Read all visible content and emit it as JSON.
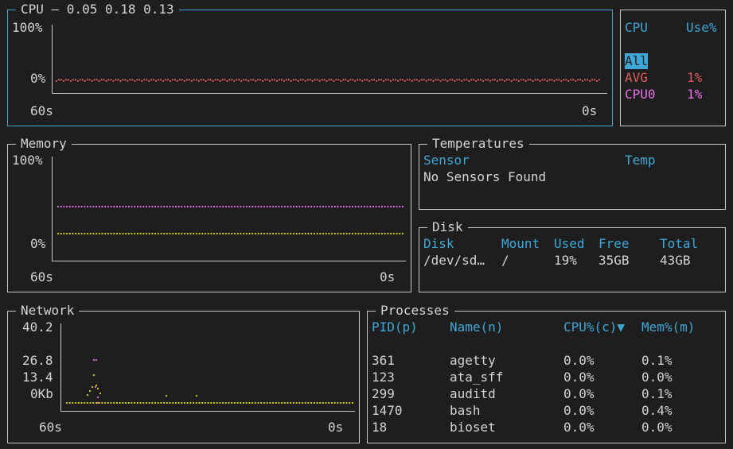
{
  "cpu": {
    "title": "CPU — 0.05 0.18 0.13",
    "y_max": "100%",
    "y_min": "0%",
    "x_start": "60s",
    "x_end": "0s",
    "line_color": "#e05b5b",
    "series_percent": [
      1,
      1,
      1,
      1,
      1,
      1,
      1,
      1,
      1,
      1,
      1,
      1,
      1,
      1,
      1,
      1,
      1,
      1,
      1,
      1,
      1,
      1,
      1,
      1,
      1,
      1,
      1,
      1,
      1,
      1,
      1,
      1,
      1,
      1,
      1,
      1,
      1,
      1,
      1,
      1,
      1,
      1,
      1,
      1,
      1,
      1,
      1,
      1,
      1,
      1,
      1,
      1,
      1,
      1,
      1,
      1,
      1,
      1,
      1,
      1
    ]
  },
  "cpu_table": {
    "col_cpu": "CPU",
    "col_use": "Use%",
    "rows": [
      {
        "name": "All",
        "value": ""
      },
      {
        "name": "AVG",
        "value": "1%"
      },
      {
        "name": "CPU0",
        "value": "1%"
      }
    ]
  },
  "memory": {
    "title": "Memory",
    "y_max": "100%",
    "y_min": "0%",
    "x_start": "60s",
    "x_end": "0s",
    "series": [
      {
        "color": "#e873e8",
        "percent": 33
      },
      {
        "color": "#d7d700",
        "percent": 5
      }
    ]
  },
  "temperatures": {
    "title": "Temperatures",
    "col_sensor": "Sensor",
    "col_temp": "Temp",
    "message": "No Sensors Found"
  },
  "disk": {
    "title": "Disk",
    "headers": [
      "Disk",
      "Mount",
      "Used",
      "Free",
      "Total"
    ],
    "rows": [
      [
        "/dev/sd…",
        "/",
        "19%",
        "35GB",
        "43GB"
      ]
    ]
  },
  "network": {
    "title": "Network",
    "y_labels": [
      "40.2",
      "26.8",
      "13.4",
      "0Kb"
    ],
    "x_start": "60s",
    "x_end": "0s",
    "rx_color": "#d7d700",
    "tx_color": "#e873e8"
  },
  "processes": {
    "title": "Processes",
    "headers": [
      "PID(p)",
      "Name(n)",
      "CPU%(c)▼",
      "Mem%(m)"
    ],
    "rows": [
      [
        "361",
        "agetty",
        "0.0%",
        "0.1%"
      ],
      [
        "123",
        "ata_sff",
        "0.0%",
        "0.0%"
      ],
      [
        "299",
        "auditd",
        "0.0%",
        "0.1%"
      ],
      [
        "1470",
        "bash",
        "0.0%",
        "0.4%"
      ],
      [
        "18",
        "bioset",
        "0.0%",
        "0.0%"
      ]
    ]
  }
}
